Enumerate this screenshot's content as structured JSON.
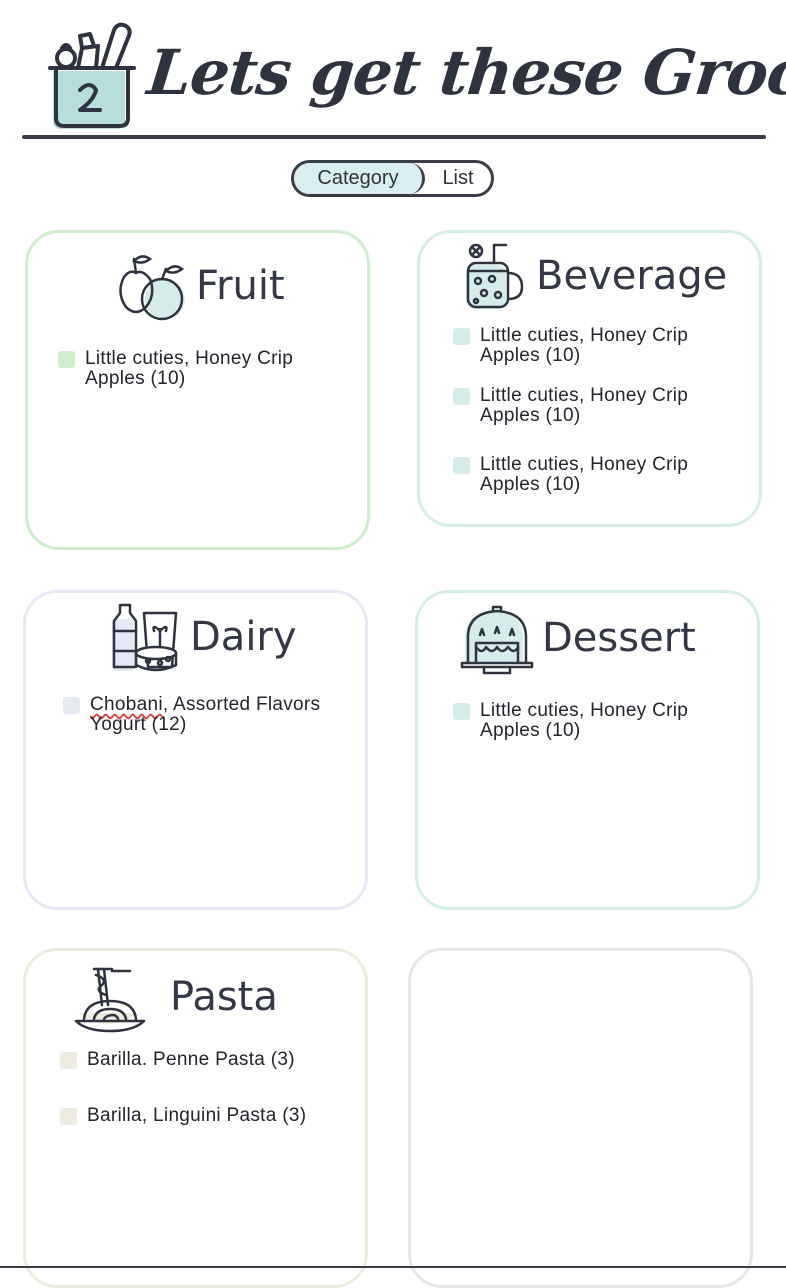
{
  "header": {
    "title": "Lets get these Groceries"
  },
  "view_toggle": {
    "active": "Category",
    "inactive": "List"
  },
  "categories": {
    "fruit": {
      "title": "Fruit",
      "accent": "#cfeccf",
      "items": [
        {
          "line1": "Little cuties, Honey Crip",
          "line2": "Apples (10)"
        }
      ]
    },
    "beverage": {
      "title": "Beverage",
      "accent": "#d6ecea",
      "items": [
        {
          "line1": "Little cuties, Honey Crip",
          "line2": "Apples (10)"
        },
        {
          "line1": "Little cuties, Honey Crip",
          "line2": "Apples (10)"
        },
        {
          "line1": "Little cuties, Honey Crip",
          "line2": "Apples (10)"
        }
      ]
    },
    "dairy": {
      "title": "Dairy",
      "accent": "#e4e9f4",
      "items": [
        {
          "brand": "Chobani",
          "rest": ", Assorted Flavors",
          "line2": "Yogurt (12)"
        }
      ]
    },
    "dessert": {
      "title": "Dessert",
      "accent": "#d6ecea",
      "items": [
        {
          "line1": "Little cuties, Honey Crip",
          "line2": "Apples (10)"
        }
      ]
    },
    "pasta": {
      "title": "Pasta",
      "accent": "#eeecdf",
      "items": [
        {
          "line1": "Barilla. Penne Pasta (3)"
        },
        {
          "line1": "Barilla, Linguini Pasta (3)"
        }
      ]
    },
    "empty": {
      "accent": "#e6e6e6"
    }
  }
}
